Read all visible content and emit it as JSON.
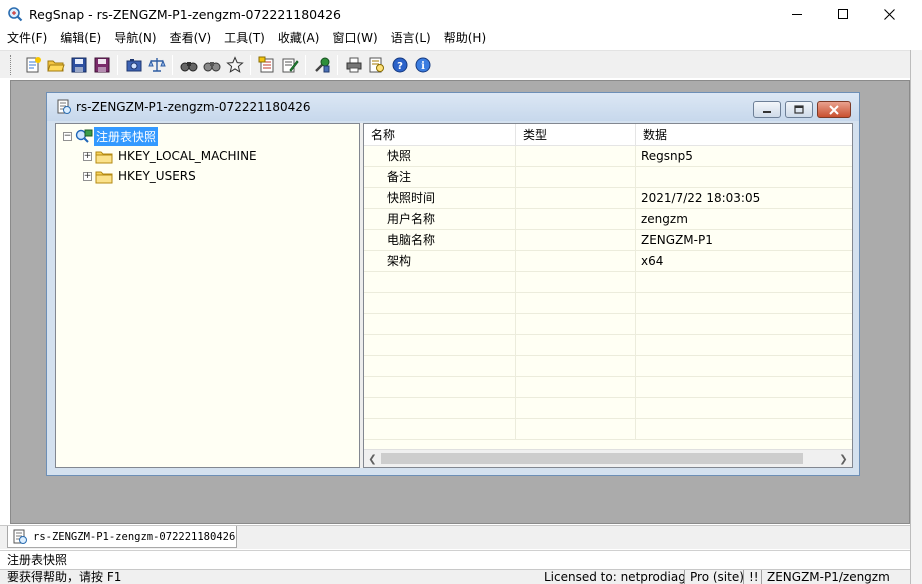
{
  "window": {
    "title": "RegSnap - rs-ZENGZM-P1-zengzm-072221180426"
  },
  "menu": [
    {
      "label": "文件(F)"
    },
    {
      "label": "编辑(E)"
    },
    {
      "label": "导航(N)"
    },
    {
      "label": "查看(V)"
    },
    {
      "label": "工具(T)"
    },
    {
      "label": "收藏(A)"
    },
    {
      "label": "窗口(W)"
    },
    {
      "label": "语言(L)"
    },
    {
      "label": "帮助(H)"
    }
  ],
  "child": {
    "title": "rs-ZENGZM-P1-zengzm-072221180426"
  },
  "tree": {
    "root": "注册表快照",
    "nodes": [
      {
        "label": "HKEY_LOCAL_MACHINE"
      },
      {
        "label": "HKEY_USERS"
      }
    ]
  },
  "list": {
    "columns": [
      "名称",
      "类型",
      "数据"
    ],
    "rows": [
      {
        "name": "快照",
        "type": "",
        "data": "Regsnp5"
      },
      {
        "name": "备注",
        "type": "",
        "data": ""
      },
      {
        "name": "快照时间",
        "type": "",
        "data": "2021/7/22 18:03:05"
      },
      {
        "name": "用户名称",
        "type": "",
        "data": "zengzm"
      },
      {
        "name": "电脑名称",
        "type": "",
        "data": "ZENGZM-P1"
      },
      {
        "name": "架构",
        "type": "",
        "data": "x64"
      }
    ]
  },
  "tab": {
    "label": "rs-ZENGZM-P1-zengzm-072221180426"
  },
  "status": {
    "selection": "注册表快照",
    "help": "要获得帮助，请按 F1",
    "license": "Licensed to: netprodiag",
    "edition": "Pro (site)",
    "flag": "!!",
    "user": "ZENGZM-P1/zengzm"
  },
  "colors": {
    "mdi_background": "#ababab",
    "tree_background": "#fffff4",
    "selection": "#3399ff",
    "close_button": "#c9502f"
  }
}
